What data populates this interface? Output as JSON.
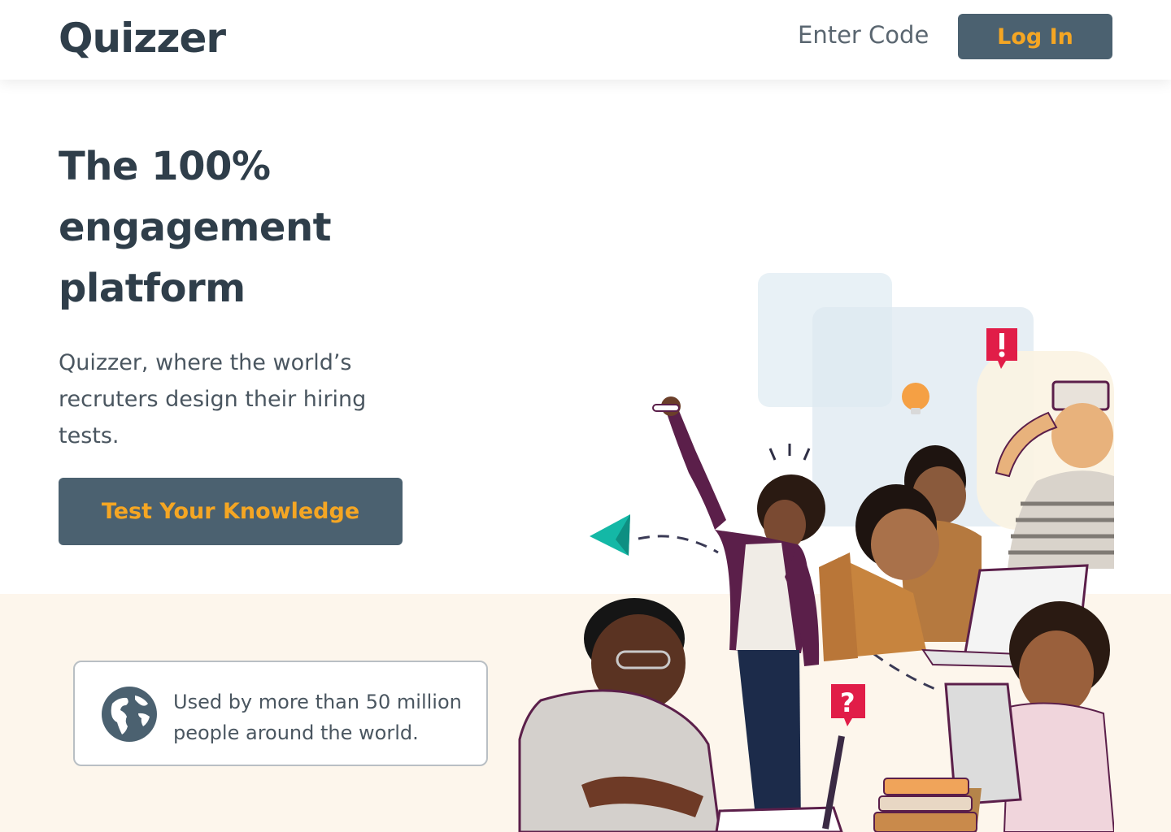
{
  "header": {
    "logo": "Quizzer",
    "enter_code": "Enter Code",
    "login": "Log In"
  },
  "hero": {
    "title_lines": [
      "The 100%",
      "engagement",
      "platform"
    ],
    "subtitle": "Quizzer, where the world’s recruters design their hiring tests.",
    "cta": "Test Your Knowledge"
  },
  "stat": {
    "icon": "globe-icon",
    "text": "Used by more than 50 million people around the world."
  },
  "colors": {
    "primary": "#4b6170",
    "accent": "#f5a623",
    "text": "#2f3e4a",
    "cream": "#fdf6ec"
  }
}
